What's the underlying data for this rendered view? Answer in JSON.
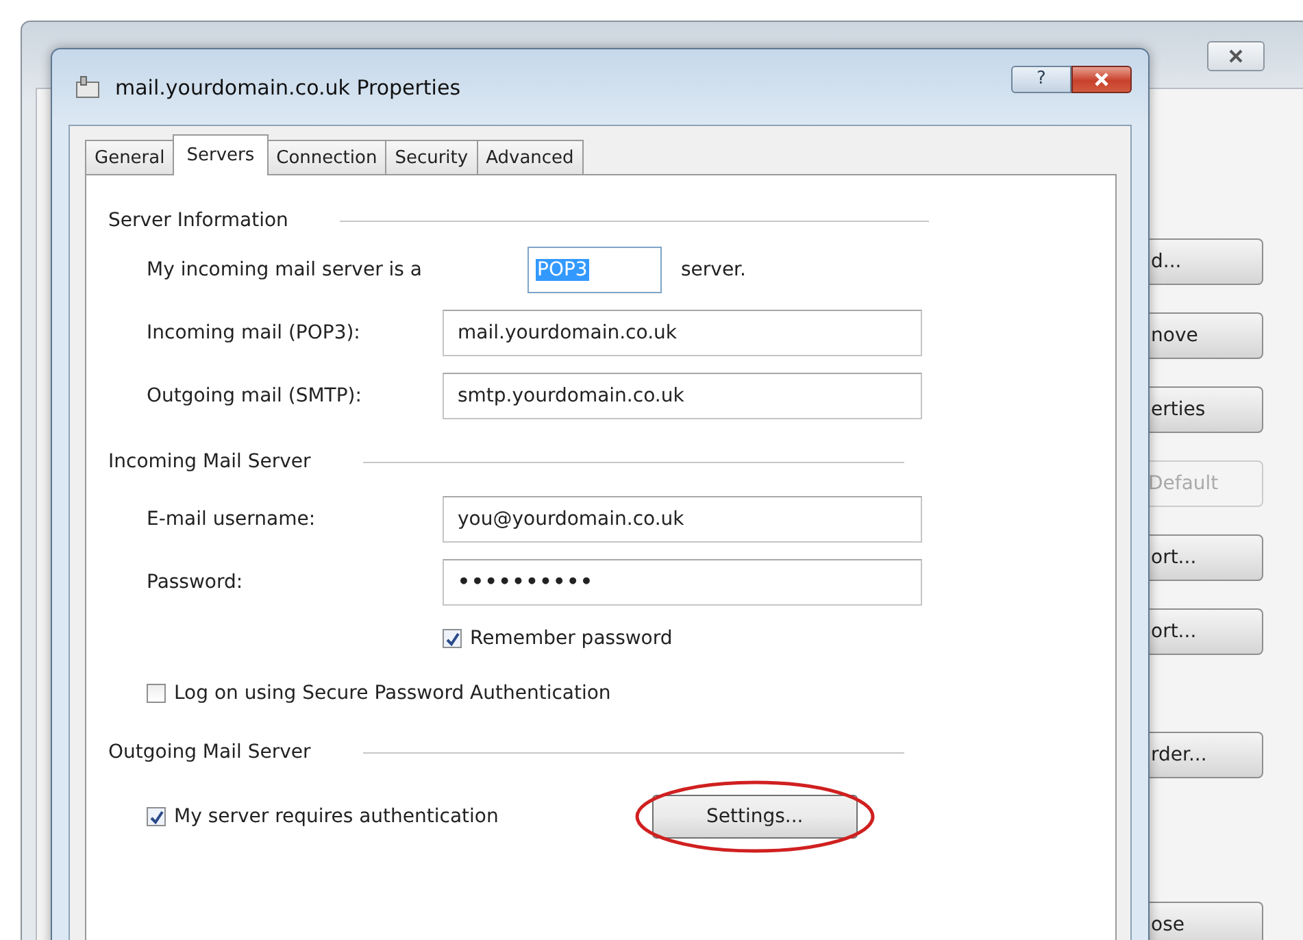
{
  "background_window": {
    "buttons": [
      {
        "label": "d...",
        "disabled": false
      },
      {
        "label": "nove",
        "disabled": false
      },
      {
        "label": "erties",
        "disabled": false
      },
      {
        "label": "Default",
        "disabled": true
      },
      {
        "label": "ort...",
        "disabled": false
      },
      {
        "label": "ort...",
        "disabled": false
      },
      {
        "label": "rder...",
        "disabled": false
      },
      {
        "label": "ose",
        "disabled": false
      }
    ]
  },
  "dialog": {
    "title": "mail.yourdomain.co.uk Properties",
    "help_button": "?",
    "tabs": [
      {
        "label": "General",
        "selected": false
      },
      {
        "label": "Servers",
        "selected": true
      },
      {
        "label": "Connection",
        "selected": false
      },
      {
        "label": "Security",
        "selected": false
      },
      {
        "label": "Advanced",
        "selected": false
      }
    ],
    "server_information": {
      "heading": "Server Information",
      "server_type_label": "My incoming mail server is a",
      "server_type_value": "POP3",
      "server_type_suffix": "server.",
      "fields": [
        {
          "label": "Incoming mail (POP3):",
          "value": "mail.yourdomain.co.uk"
        },
        {
          "label": "Outgoing mail (SMTP):",
          "value": "smtp.yourdomain.co.uk"
        }
      ]
    },
    "incoming_mail_server": {
      "heading": "Incoming Mail Server",
      "fields": [
        {
          "label": "E-mail username:",
          "value": "you@yourdomain.co.uk"
        },
        {
          "label": "Password:",
          "value": "••••••••••"
        }
      ],
      "remember_password": {
        "label": "Remember password",
        "checked": true
      },
      "secure_auth": {
        "label": "Log on using Secure Password Authentication",
        "checked": false
      }
    },
    "outgoing_mail_server": {
      "heading": "Outgoing Mail Server",
      "requires_auth": {
        "label": "My server requires authentication",
        "checked": true
      },
      "settings_button": "Settings...",
      "settings_highlighted": true
    }
  }
}
